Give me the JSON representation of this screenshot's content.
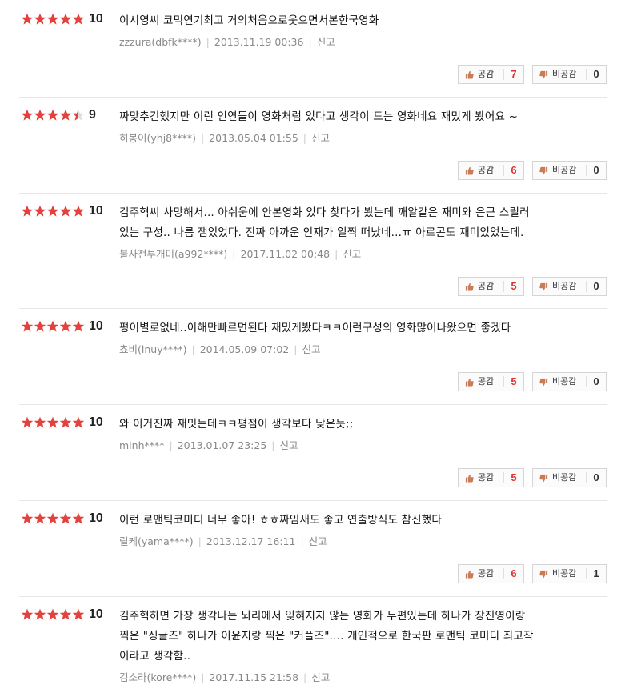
{
  "labels": {
    "like": "공감",
    "dislike": "비공감",
    "report": "신고"
  },
  "colors": {
    "star": "#e3423c",
    "like_count": "#dd3333",
    "thumb": "#c97a57"
  },
  "icons": {
    "star": "star-icon",
    "like": "thumbs-up-icon",
    "dislike": "thumbs-down-icon"
  },
  "reviews": [
    {
      "stars": 5,
      "score": "10",
      "lines": [
        "이시영씨 코믹연기최고 거의처음으로웃으면서본한국영화"
      ],
      "user": "zzzura(dbfk****)",
      "date": "2013.11.19 00:36",
      "likes": "7",
      "dislikes": "0"
    },
    {
      "stars": 4.5,
      "score": "9",
      "lines": [
        "짜맞추긴했지만 이런 인연들이 영화처럼 있다고 생각이 드는 영화네요 재밌게 봤어요 ~"
      ],
      "user": "히봉이(yhj8****)",
      "date": "2013.05.04 01:55",
      "likes": "6",
      "dislikes": "0"
    },
    {
      "stars": 5,
      "score": "10",
      "lines": [
        "김주혁씨 사망해서... 아쉬움에 안본영화 있다 찾다가 봤는데 깨알같은 재미와 은근 스릴러",
        "있는 구성.. 나름 잼있었다. 진짜 아까운 인재가 일찍 떠났네...ㅠ 아르곤도 재미있었는데."
      ],
      "user": "불사전투개미(a992****)",
      "date": "2017.11.02 00:48",
      "likes": "5",
      "dislikes": "0"
    },
    {
      "stars": 5,
      "score": "10",
      "lines": [
        "평이별로없네..이해만빠르면된다 재밌게봤다ㅋㅋ이런구성의 영화많이나왔으면 좋겠다"
      ],
      "user": "쵸비(lnuy****)",
      "date": "2014.05.09 07:02",
      "likes": "5",
      "dislikes": "0"
    },
    {
      "stars": 5,
      "score": "10",
      "lines": [
        "와 이거진짜 재밋는데ㅋㅋ평점이 생각보다 낮은듯;;"
      ],
      "user": "minh****",
      "date": "2013.01.07 23:25",
      "likes": "5",
      "dislikes": "0"
    },
    {
      "stars": 5,
      "score": "10",
      "lines": [
        "이런 로맨틱코미디 너무 좋아! ㅎㅎ짜임새도 좋고 연출방식도 참신했다"
      ],
      "user": "릴케(yama****)",
      "date": "2013.12.17 16:11",
      "likes": "6",
      "dislikes": "1"
    },
    {
      "stars": 5,
      "score": "10",
      "lines": [
        "김주혁하면 가장 생각나는 뇌리에서 잊혀지지 않는 영화가 두편있는데 하나가 장진영이랑",
        "찍은 \"싱글즈\" 하나가 이윤지랑 찍은 \"커플즈\".... 개인적으로 한국판 로맨틱 코미디 최고작",
        "이라고 생각함.."
      ],
      "user": "김소라(kore****)",
      "date": "2017.11.15 21:58",
      "likes": "",
      "dislikes": ""
    }
  ]
}
